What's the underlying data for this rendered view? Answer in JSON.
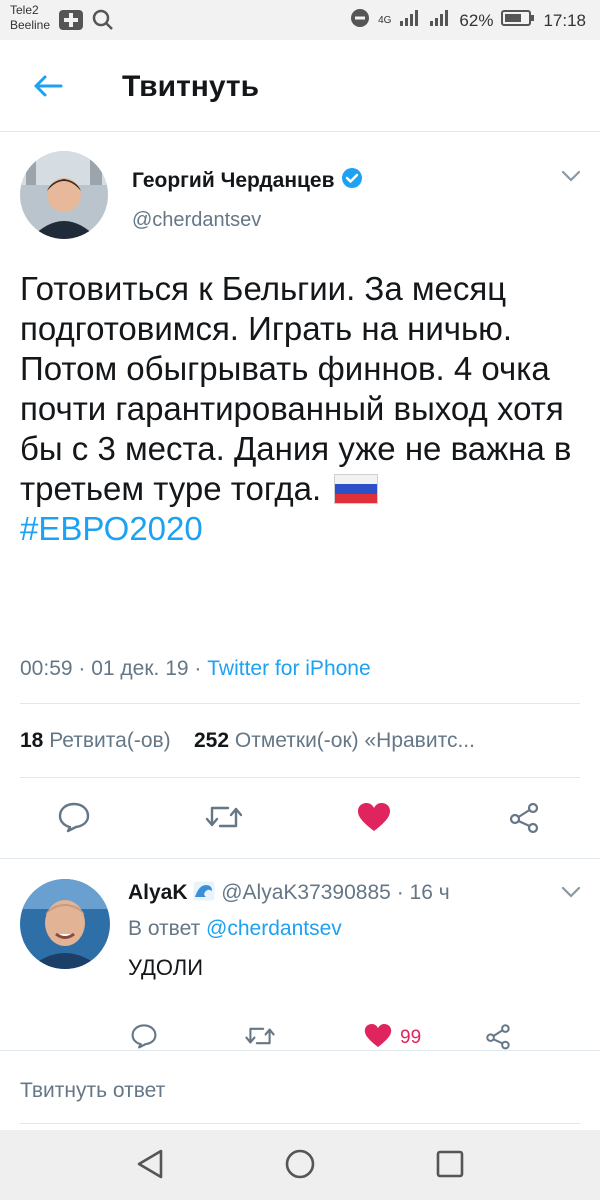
{
  "status_bar": {
    "carrier_1": "Tele2",
    "carrier_2": "Beeline",
    "network": "4G",
    "battery": "62%",
    "time": "17:18"
  },
  "header": {
    "title": "Твитнуть",
    "back_icon": "arrow-left-icon"
  },
  "tweet": {
    "author_name": "Георгий Черданцев",
    "handle": "@cherdantsev",
    "verified": true,
    "text": "Готовиться к Бельгии. За месяц подготовимся. Играть на ничью. Потом обыгрывать финнов. 4 очка почти гарантированный выход хотя бы с 3 места. Дания уже не важна в третьем туре тогда.",
    "hashtag": "#ЕВРО2020",
    "time": "00:59",
    "date": "01 дек. 19",
    "source": "Twitter for iPhone",
    "retweets_count": "18",
    "retweets_label": "Ретвита(-ов)",
    "likes_count": "252",
    "likes_label": "Отметки(-ок) «Нравитс...",
    "liked": true,
    "colors": {
      "accent": "#1da1f2",
      "like": "#e0245e",
      "secondary": "#657786"
    }
  },
  "reply": {
    "author_name": "AlyaK",
    "name_emoji": "wave-icon",
    "handle": "@AlyaK37390885",
    "age": "16 ч",
    "reply_prefix": "В ответ",
    "reply_to": "@cherdantsev",
    "text": "УДОЛИ",
    "likes": "99"
  },
  "compose": {
    "placeholder": "Твитнуть ответ"
  }
}
